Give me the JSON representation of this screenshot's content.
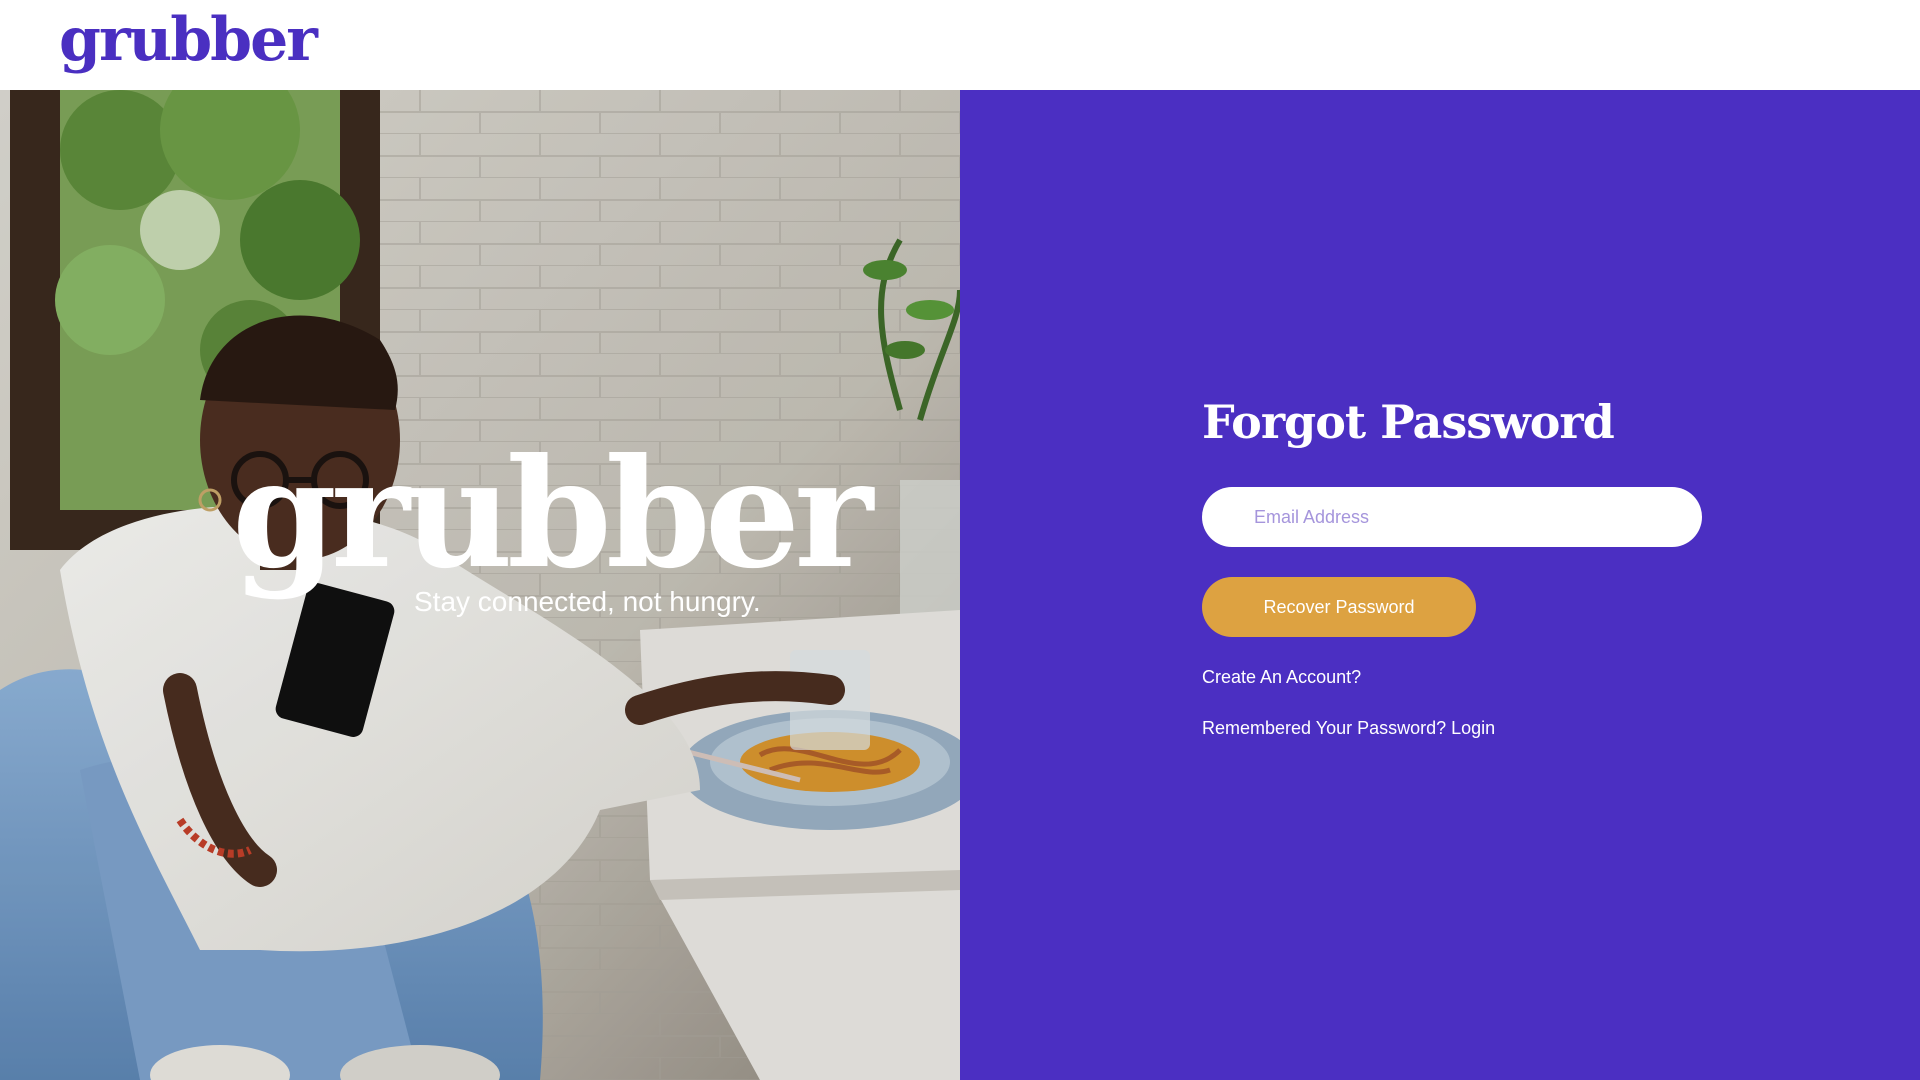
{
  "header": {
    "logo_text": "grubber"
  },
  "hero": {
    "brand_text": "grubber",
    "tagline": "Stay connected, not hungry."
  },
  "form": {
    "title": "Forgot Password",
    "email_placeholder": "Email Address",
    "email_value": "",
    "recover_button_label": "Recover Password",
    "create_account_link": "Create An Account?",
    "login_link": "Remembered Your Password? Login"
  },
  "colors": {
    "brand_purple": "#4b2fc2",
    "button_gold": "#dda241",
    "header_bg": "#ffffff"
  }
}
